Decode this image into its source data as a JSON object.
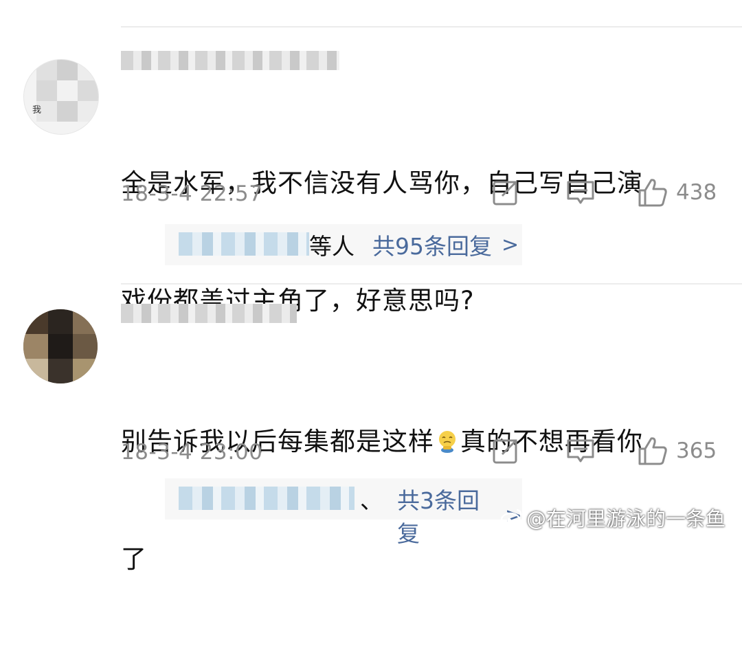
{
  "comments": [
    {
      "avatar_text": "我",
      "text_lines": [
        "全是水军，我不信没有人骂你，自己写自己演",
        "戏份都盖过主角了，好意思吗?"
      ],
      "timestamp": "18-3-4 22:57",
      "like_count": "438",
      "reply_suffix": "等人",
      "reply_link": "共95条回复",
      "reply_chevron": ">"
    },
    {
      "text_before_emoji": "别告诉我以后每集都是这样",
      "text_after_emoji": "真的不想再看你",
      "text_line2": "了",
      "timestamp": "18-3-4 23:00",
      "like_count": "365",
      "reply_suffix": "、",
      "reply_link": "共3条回复",
      "reply_chevron": ">"
    }
  ],
  "icons": {
    "share": "share-icon",
    "comment": "comment-icon",
    "like": "thumbs-up-icon",
    "emoji": "crying-emoji-icon",
    "watermark_logo": "weibo-logo-icon"
  },
  "watermark": "@在河里游泳的一条鱼",
  "colors": {
    "link": "#4a6a9c",
    "meta_gray": "#8c8c8c",
    "divider": "#ececec"
  }
}
